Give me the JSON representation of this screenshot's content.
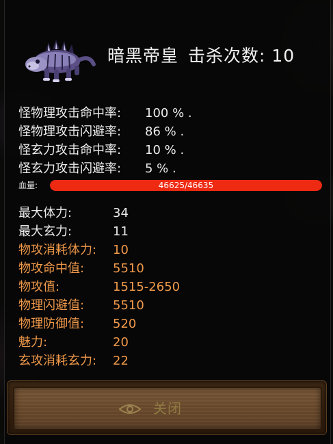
{
  "colors": {
    "white_text": "#ececec",
    "orange_text": "#f0994a",
    "hp_fill": "#ee2a12"
  },
  "header": {
    "monster_name": "暗黑帝皇",
    "kill_label": "击杀次数:",
    "kill_count": "10",
    "monster_icon": "dark-creature-portrait"
  },
  "rates": [
    {
      "label": "怪物理攻击命中率:",
      "value": "100 % ."
    },
    {
      "label": "怪物理攻击闪避率:",
      "value": "86 % ."
    },
    {
      "label": "怪玄力攻击命中率:",
      "value": "10 % ."
    },
    {
      "label": "怪玄力攻击闪避率:",
      "value": "5 % ."
    }
  ],
  "hp": {
    "label": "血量:",
    "text": "46625/46635",
    "fraction": 0.9998
  },
  "attributes": [
    {
      "label": "最大体力:",
      "value": "34",
      "color": "#ececec"
    },
    {
      "label": "最大玄力:",
      "value": "11",
      "color": "#ececec"
    },
    {
      "label": "物攻消耗体力:",
      "value": "10",
      "color": "#f0994a"
    },
    {
      "label": "物攻命中值:",
      "value": "5510",
      "color": "#f0994a"
    },
    {
      "label": "物攻值:",
      "value": "1515-2650",
      "color": "#f0994a"
    },
    {
      "label": "物理闪避值:",
      "value": "5510",
      "color": "#f0994a"
    },
    {
      "label": "物理防御值:",
      "value": "520",
      "color": "#f0994a"
    },
    {
      "label": "魅力:",
      "value": "20",
      "color": "#f0994a"
    },
    {
      "label": "玄攻消耗玄力:",
      "value": "22",
      "color": "#f0994a"
    }
  ],
  "footer": {
    "close_label": "关闭",
    "close_icon": "eye-emblem-icon"
  }
}
